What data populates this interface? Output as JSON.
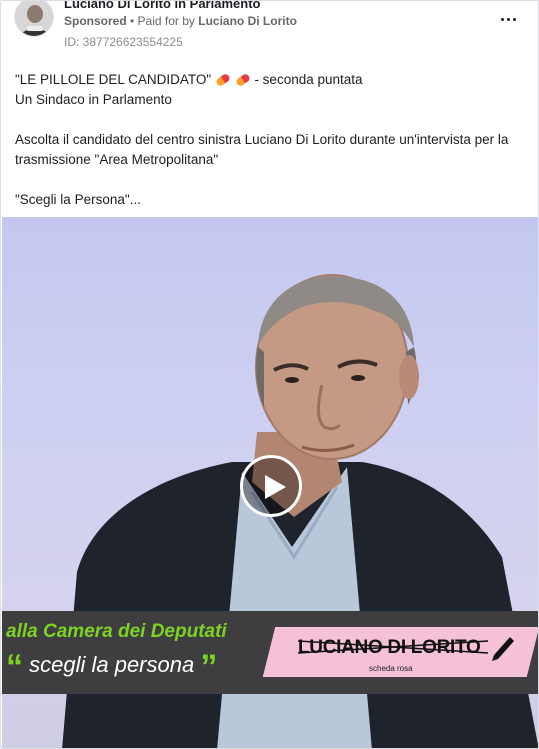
{
  "post": {
    "page_name": "Luciano Di Lorito in Parlamento",
    "sponsored_label": "Sponsored",
    "separator": " • ",
    "paid_for_prefix": "Paid for by ",
    "paid_for_name": "Luciano Di Lorito",
    "ad_id": "ID: 387726623554225"
  },
  "body": {
    "line1_before": "\"LE PILLOLE DEL CANDIDATO\"",
    "line1_after": " - seconda puntata",
    "line2": "Un Sindaco in Parlamento",
    "line3": "Ascolta il candidato del centro sinistra Luciano Di Lorito durante un'intervista per la trasmissione \"Area Metropolitana\"",
    "line4": "\"Scegli la Persona\"..."
  },
  "video": {
    "banner_line1": "alla Camera dei Deputati",
    "open_quote": "“",
    "banner_line2": " scegli  la persona",
    "close_quote": "”",
    "ballot_name": "LUCIANO DI LORITO",
    "ballot_sub": "scheda rosa"
  },
  "icons": {
    "more": "more-horizontal-icon",
    "play": "play-icon",
    "pill": "pill-emoji",
    "pencil": "pencil-icon"
  },
  "colors": {
    "banner_green": "#7dd321",
    "ballot_pink": "#f4c1d6",
    "banner_bg": "#3e3e40"
  }
}
